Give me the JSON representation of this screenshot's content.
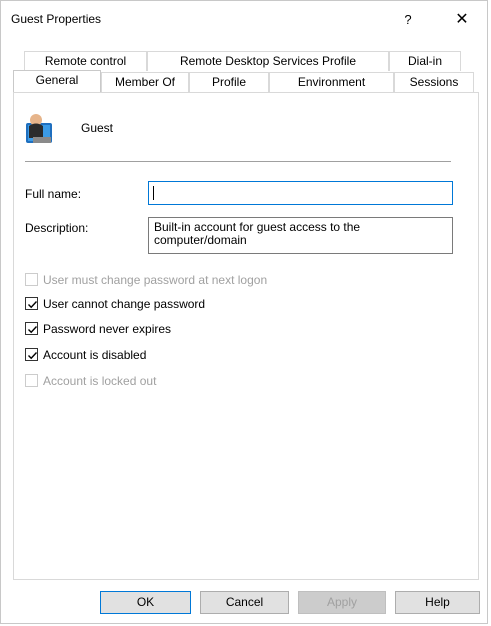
{
  "window": {
    "title": "Guest Properties",
    "help_label": "?",
    "close_label": "✕"
  },
  "tabs_row1": [
    {
      "label": "Remote control"
    },
    {
      "label": "Remote Desktop Services Profile"
    },
    {
      "label": "Dial-in"
    }
  ],
  "tabs_row2": [
    {
      "label": "General",
      "active": true
    },
    {
      "label": "Member Of"
    },
    {
      "label": "Profile"
    },
    {
      "label": "Environment"
    },
    {
      "label": "Sessions"
    }
  ],
  "general": {
    "user_icon": "user-account-icon",
    "username": "Guest",
    "full_name_label": "Full name:",
    "full_name_value": "",
    "description_label": "Description:",
    "description_value": "Built-in account for guest access to the computer/domain",
    "checkboxes": [
      {
        "label": "User must change password at next logon",
        "checked": false,
        "enabled": false
      },
      {
        "label": "User cannot change password",
        "checked": true,
        "enabled": true
      },
      {
        "label": "Password never expires",
        "checked": true,
        "enabled": true
      },
      {
        "label": "Account is disabled",
        "checked": true,
        "enabled": true
      },
      {
        "label": "Account is locked out",
        "checked": false,
        "enabled": false
      }
    ]
  },
  "buttons": {
    "ok": "OK",
    "cancel": "Cancel",
    "apply": "Apply",
    "help": "Help"
  }
}
